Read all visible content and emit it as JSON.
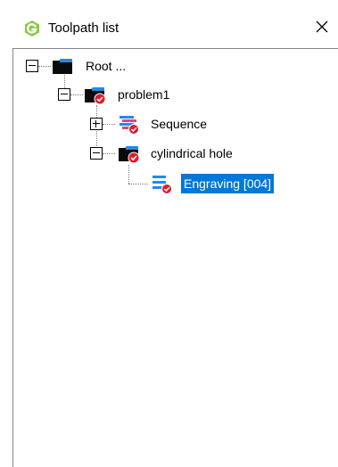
{
  "window": {
    "title": "Toolpath list",
    "close_glyph": "✕",
    "app_icon": "cimatron-logo-icon",
    "accent_color": "#8cc63f"
  },
  "tree": {
    "selection_color": "#0078d7",
    "nodes": [
      {
        "label": "Root ...",
        "icon": "folder-icon",
        "expanded": true,
        "selected": false
      },
      {
        "label": "problem1",
        "icon": "folder-check-icon",
        "expanded": true,
        "selected": false
      },
      {
        "label": "Sequence",
        "icon": "sequence-check-icon",
        "expanded": false,
        "selected": false
      },
      {
        "label": "cylindrical hole",
        "icon": "folder-check-icon",
        "expanded": true,
        "selected": false
      },
      {
        "label": "Engraving [004]",
        "icon": "toolpath-check-icon",
        "expanded": null,
        "selected": true
      }
    ]
  }
}
